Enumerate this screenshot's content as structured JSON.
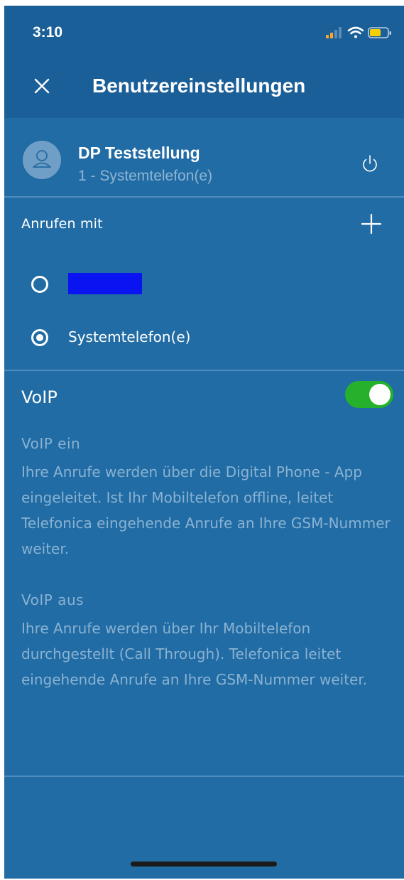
{
  "status_bar": {
    "time": "3:10"
  },
  "header": {
    "title": "Benutzereinstellungen"
  },
  "profile": {
    "name": "DP Teststellung",
    "subtitle": "1 - Systemtelefon(e)"
  },
  "call_with": {
    "label": "Anrufen mit",
    "options": [
      {
        "label": "",
        "selected": false,
        "redacted": true
      },
      {
        "label": "Systemtelefon(e)",
        "selected": true
      }
    ]
  },
  "voip": {
    "label": "VoIP",
    "enabled": true,
    "on_title": "VoIP ein",
    "on_text": "Ihre Anrufe werden über die Digital Phone - App eingeleitet. Ist Ihr Mobiltelefon offline, leitet Telefonica eingehende Anrufe an Ihre GSM-Nummer weiter.",
    "off_title": "VoIP aus",
    "off_text": "Ihre Anrufe werden über Ihr Mobiltelefon durchgestellt (Call Through). Telefonica leitet eingehende Anrufe an Ihre GSM-Nummer weiter."
  },
  "colors": {
    "background": "#216ca4",
    "header": "#1b5f99",
    "toggle_on": "#25b12c",
    "muted_text": "#8ab2d3"
  }
}
